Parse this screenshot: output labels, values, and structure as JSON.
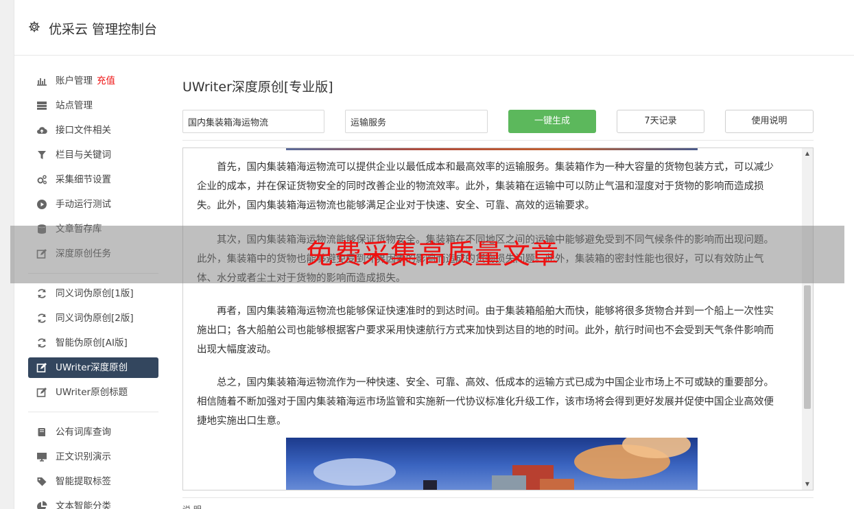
{
  "header": {
    "title": "优采云 管理控制台",
    "icon": "gear-icon"
  },
  "sidebar": {
    "group1": [
      {
        "label": "账户管理",
        "badge": "充值",
        "icon": "bar-chart-icon"
      },
      {
        "label": "站点管理",
        "icon": "server-icon"
      },
      {
        "label": "接口文件相关",
        "icon": "cloud-upload-icon"
      },
      {
        "label": "栏目与关键词",
        "icon": "filter-icon"
      },
      {
        "label": "采集细节设置",
        "icon": "cogs-icon"
      },
      {
        "label": "手动运行测试",
        "icon": "play-circle-icon"
      },
      {
        "label": "文章暂存库",
        "icon": "database-icon"
      },
      {
        "label": "深度原创任务",
        "icon": "edit-icon"
      }
    ],
    "group2": [
      {
        "label": "同义词伪原创[1版]",
        "icon": "refresh-icon"
      },
      {
        "label": "同义词伪原创[2版]",
        "icon": "refresh-icon"
      },
      {
        "label": "智能伪原创[AI版]",
        "icon": "refresh-icon"
      },
      {
        "label": "UWriter深度原创",
        "icon": "edit-icon",
        "active": true
      },
      {
        "label": "UWriter原创标题",
        "icon": "edit-icon"
      }
    ],
    "group3": [
      {
        "label": "公有词库查询",
        "icon": "book-icon"
      },
      {
        "label": "正文识别演示",
        "icon": "monitor-icon"
      },
      {
        "label": "智能提取标签",
        "icon": "tag-icon"
      },
      {
        "label": "文本智能分类",
        "icon": "pie-chart-icon"
      }
    ]
  },
  "main": {
    "title": "UWriter深度原创[专业版]",
    "keyword1": "国内集装箱海运物流",
    "keyword2": "运输服务",
    "generate_btn": "一键生成",
    "history_btn": "7天记录",
    "help_btn": "使用说明",
    "paragraphs": [
      "首先，国内集装箱海运物流可以提供企业以最低成本和最高效率的运输服务。集装箱作为一种大容量的货物包装方式，可以减少企业的成本，并在保证货物安全的同时改善企业的物流效率。此外，集装箱在运输中可以防止气温和湿度对于货物的影响而造成损失。此外，国内集装箱海运物流也能够满足企业对于快速、安全、可靠、高效的运输要求。",
      "其次，国内集装箱海运物流能够保证货物安全。集装箱在不同地区之间的运输中能够避免受到不同气候条件的影响而出现问题。此外，集装箱中的货物也能够避免受到外界因素的影响而造成的货物损失问题。此外，集装箱的密封性能也很好，可以有效防止气体、水分或者尘土对于货物的影响而造成损失。",
      "再者，国内集装箱海运物流也能够保证快速准时的到达时间。由于集装箱船舶大而快，能够将很多货物合并到一个船上一次性实施出口；各大船舶公司也能够根据客户要求采用快速航行方式来加快到达目的地的时间。此外，航行时间也不会受到天气条件影响而出现大幅度波动。",
      "总之，国内集装箱海运物流作为一种快速、安全、可靠、高效、低成本的运输方式已成为中国企业市场上不可或缺的重要部分。相信随着不断加强对于国内集装箱海运市场监管和实施新一代协议标准化升级工作，该市场将会得到更好发展并促使中国企业高效便捷地实施出口生意。"
    ],
    "bottom_label": "说 明"
  },
  "overlay": {
    "text": "免费采集高质量文章"
  },
  "colors": {
    "active_bg": "#33465e",
    "green": "#5cb85c",
    "badge_red": "#e11111",
    "overlay_text": "#ee1111"
  }
}
